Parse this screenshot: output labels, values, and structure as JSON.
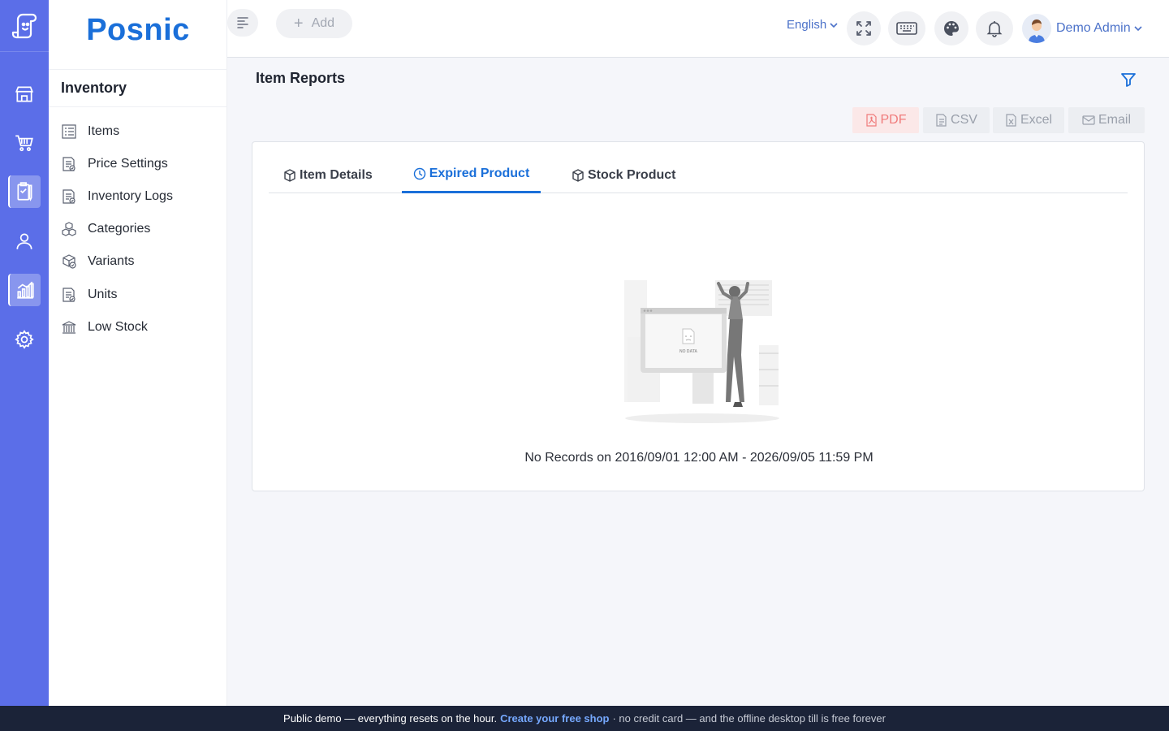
{
  "app": {
    "brand": "Posnic"
  },
  "rail": {
    "items": [
      {
        "icon": "store-icon"
      },
      {
        "icon": "cart-icon"
      },
      {
        "icon": "clipboard-icon"
      },
      {
        "icon": "user-icon"
      },
      {
        "icon": "chart-icon"
      },
      {
        "icon": "gear-icon"
      }
    ]
  },
  "sidebar": {
    "heading": "Inventory",
    "items": [
      {
        "label": "Items",
        "icon": "list-icon"
      },
      {
        "label": "Price Settings",
        "icon": "document-icon"
      },
      {
        "label": "Inventory Logs",
        "icon": "document-icon"
      },
      {
        "label": "Categories",
        "icon": "cubes-icon"
      },
      {
        "label": "Variants",
        "icon": "box-check-icon"
      },
      {
        "label": "Units",
        "icon": "document-icon"
      },
      {
        "label": "Low Stock",
        "icon": "bank-icon"
      }
    ]
  },
  "header": {
    "add_label": "Add",
    "language": "English",
    "user_name": "Demo Admin"
  },
  "page": {
    "title": "Item Reports",
    "export_buttons": {
      "pdf": "PDF",
      "csv": "CSV",
      "excel": "Excel",
      "email": "Email"
    },
    "tabs": [
      {
        "label": "Item Details",
        "icon": "box-icon"
      },
      {
        "label": "Expired Product",
        "icon": "clock-icon"
      },
      {
        "label": "Stock Product",
        "icon": "box-icon"
      }
    ],
    "active_tab": "Expired Product",
    "empty_text": "No Records on 2016/09/01 12:00 AM - 2026/09/05 11:59 PM",
    "illustration_label": "NO DATA"
  },
  "banner": {
    "lead": "Public demo — everything resets on the hour.",
    "link": "Create your free shop",
    "tail": "· no credit card — and the offline desktop till is free forever"
  },
  "colors": {
    "rail": "#5b6ee8",
    "brand": "#1a6fd9",
    "accent": "#4c72c9",
    "banner": "#1b2338"
  }
}
